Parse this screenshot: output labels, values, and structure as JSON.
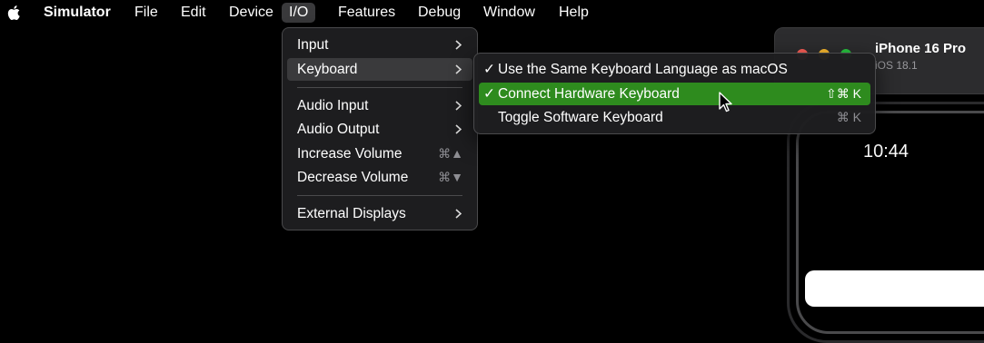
{
  "menubar": {
    "app_name": "Simulator",
    "items": [
      "File",
      "Edit",
      "Device",
      "I/O",
      "Features",
      "Debug",
      "Window",
      "Help"
    ],
    "active": "I/O"
  },
  "io_menu": {
    "items": [
      {
        "label": "Input",
        "submenu": true
      },
      {
        "label": "Keyboard",
        "submenu": true,
        "highlighted": true
      },
      {
        "label": "Audio Input",
        "submenu": true
      },
      {
        "label": "Audio Output",
        "submenu": true
      },
      {
        "label": "Increase Volume",
        "shortcut": "⌘▲"
      },
      {
        "label": "Decrease Volume",
        "shortcut": "⌘▼"
      },
      {
        "label": "External Displays",
        "submenu": true
      }
    ]
  },
  "keyboard_menu": {
    "items": [
      {
        "label": "Use the Same Keyboard Language as macOS",
        "checked": true,
        "shortcut": ""
      },
      {
        "label": "Connect Hardware Keyboard",
        "checked": true,
        "shortcut": "⇧⌘ K",
        "selected": true
      },
      {
        "label": "Toggle Software Keyboard",
        "checked": false,
        "shortcut": "⌘ K"
      }
    ]
  },
  "simulator": {
    "device_name": "iPhone 16 Pro",
    "os_version": "iOS 18.1",
    "time": "10:44"
  },
  "colors": {
    "selection_green": "#2e8b1e",
    "traffic_red": "#ff5f57",
    "traffic_yellow": "#febc2e",
    "traffic_green": "#28c840"
  }
}
